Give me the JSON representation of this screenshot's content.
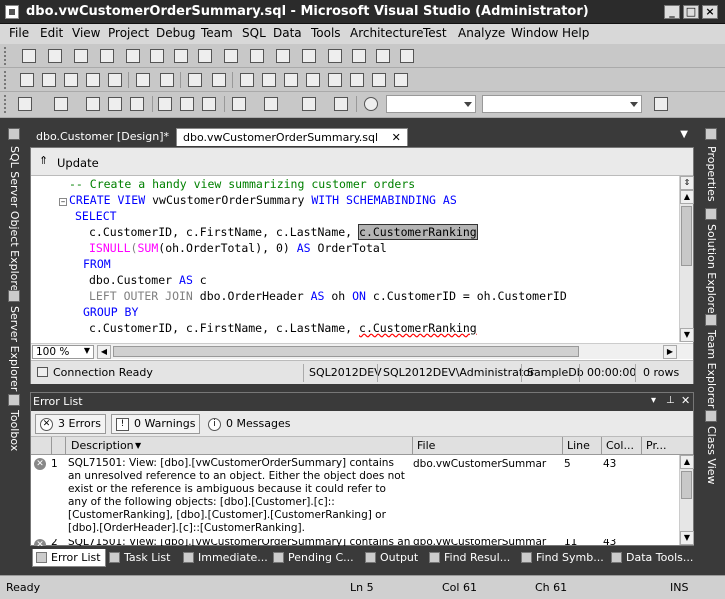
{
  "window": {
    "title": "dbo.vwCustomerOrderSummary.sql - Microsoft Visual Studio (Administrator)"
  },
  "menu": [
    "File",
    "Edit",
    "View",
    "Project",
    "Debug",
    "Team",
    "SQL",
    "Data",
    "Tools",
    "Architecture",
    "Test",
    "Analyze",
    "Window",
    "Help"
  ],
  "left_strip": {
    "sql_server_object_explorer": "SQL Server Object Explorer",
    "server_explorer": "Server Explorer",
    "toolbox": "Toolbox"
  },
  "right_strip": {
    "properties": "Properties",
    "solution_explorer": "Solution Explorer",
    "team_explorer": "Team Explorer",
    "class_view": "Class View"
  },
  "doc_tabs": [
    {
      "label": "dbo.Customer [Design]*",
      "active": false
    },
    {
      "label": "dbo.vwCustomerOrderSummary.sql",
      "active": true
    }
  ],
  "editor": {
    "update_button": "Update",
    "lines": {
      "l1": "-- Create a handy view summarizing customer orders",
      "l2_kw1": "CREATE VIEW",
      "l2_name": " vwCustomerOrderSummary ",
      "l2_kw2": "WITH SCHEMABINDING AS",
      "l3": "SELECT",
      "l4a": "c.CustomerID, c.FirstName, c.LastName, ",
      "l4b": "c.CustomerRanking",
      "l5_fn1": "ISNULL",
      "l5_p1": "(",
      "l5_fn2": "SUM",
      "l5_p2": "(oh.OrderTotal), 0) ",
      "l5_kw": "AS",
      "l5_rest": " OrderTotal",
      "l6": "FROM",
      "l7a": "dbo.Customer ",
      "l7_kw": "AS",
      "l7b": " c",
      "l8_kw": "LEFT OUTER JOIN",
      "l8a": " dbo.OrderHeader ",
      "l8_kw2": "AS",
      "l8b": " oh ",
      "l8_kw3": "ON",
      "l8c": " c.CustomerID = oh.CustomerID",
      "l9": "GROUP BY",
      "l10a": "c.CustomerID, c.FirstName, c.LastName, ",
      "l10b": "c.CustomerRanking"
    },
    "zoom": "100 %",
    "status": {
      "connection": "Connection Ready",
      "server": "SQL2012DEV",
      "user": "SQL2012DEV\\Administrator",
      "database": "SampleDb",
      "time": "00:00:00",
      "rows": "0 rows"
    }
  },
  "error_list": {
    "title": "Error List",
    "errors_filter": "3 Errors",
    "warnings_filter": "0 Warnings",
    "messages_filter": "0 Messages",
    "columns": {
      "description": "Description",
      "file": "File",
      "line": "Line",
      "col": "Col...",
      "project": "Pr..."
    },
    "rows": [
      {
        "num": "1",
        "description": "SQL71501: View: [dbo].[vwCustomerOrderSummary] contains an unresolved reference to an object. Either the object does not exist or the reference is ambiguous because it could refer to any of the following objects: [dbo].[Customer].[c]::[CustomerRanking], [dbo].[Customer].[CustomerRanking] or [dbo].[OrderHeader].[c]::[CustomerRanking].",
        "file": "dbo.vwCustomerSummar",
        "line": "5",
        "col": "43"
      },
      {
        "num": "2",
        "description": "SQL71501: View: [dbo].[vwCustomerOrderSummary] contains an",
        "file": "dbo.vwCustomerSummar",
        "line": "11",
        "col": "43"
      }
    ]
  },
  "bottom_tabs": [
    "Error List",
    "Task List",
    "Immediate...",
    "Pending C...",
    "Output",
    "Find Resul...",
    "Find Symb...",
    "Data Tools..."
  ],
  "statusbar": {
    "ready": "Ready",
    "ln": "Ln 5",
    "col": "Col 61",
    "ch": "Ch 61",
    "ins": "INS"
  }
}
